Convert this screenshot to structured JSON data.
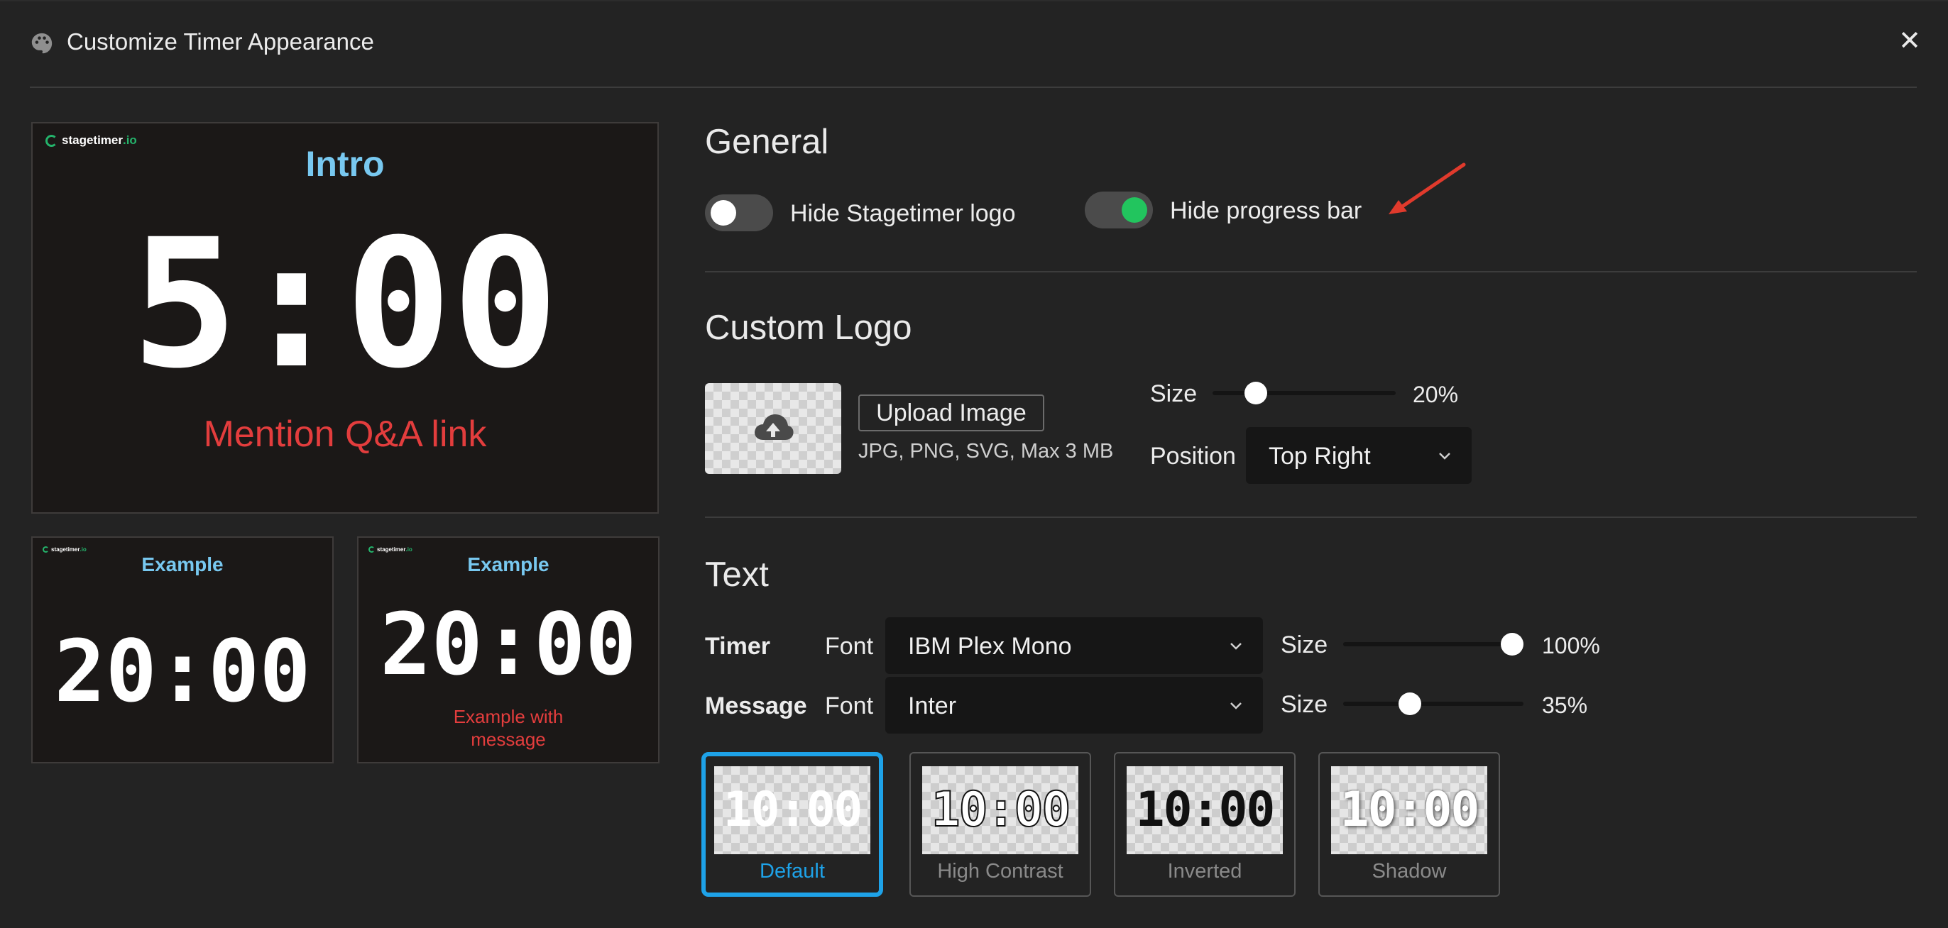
{
  "dialog": {
    "title": "Customize Timer Appearance"
  },
  "preview_main": {
    "logo_text": "stagetimer",
    "logo_suffix": ".io",
    "title": "Intro",
    "timer": "5:00",
    "message": "Mention Q&A link"
  },
  "preview_small1": {
    "logo_text": "stagetimer",
    "logo_suffix": ".io",
    "title": "Example",
    "timer": "20:00"
  },
  "preview_small2": {
    "logo_text": "stagetimer",
    "logo_suffix": ".io",
    "title": "Example",
    "timer": "20:00",
    "message": "Example with message"
  },
  "general": {
    "heading": "General",
    "hide_logo": {
      "label": "Hide Stagetimer logo",
      "on": false
    },
    "hide_progress": {
      "label": "Hide progress bar",
      "on": true
    },
    "annotation_arrow_color": "#e03a2c"
  },
  "custom_logo": {
    "heading": "Custom Logo",
    "upload_label": "Upload Image",
    "hint": "JPG, PNG, SVG, Max 3 MB",
    "size_label": "Size",
    "size_value": 20,
    "size_text": "20%",
    "position_label": "Position",
    "position_value": "Top Right"
  },
  "text": {
    "heading": "Text",
    "timer": {
      "label": "Timer",
      "font_label": "Font",
      "font_value": "IBM Plex Mono",
      "size_label": "Size",
      "size_value": 100,
      "size_text": "100%"
    },
    "message": {
      "label": "Message",
      "font_label": "Font",
      "font_value": "Inter",
      "size_label": "Size",
      "size_value": 35,
      "size_text": "35%"
    },
    "styles": [
      {
        "name": "Default",
        "sample": "10:00",
        "selected": true
      },
      {
        "name": "High Contrast",
        "sample": "10:00",
        "selected": false
      },
      {
        "name": "Inverted",
        "sample": "10:00",
        "selected": false
      },
      {
        "name": "Shadow",
        "sample": "10:00",
        "selected": false
      }
    ]
  },
  "colors": {
    "accent": "#1ea2e8",
    "toggle_on": "#22c55e",
    "title_blue": "#78c8f0",
    "message_red": "#e33d3d",
    "brand_green": "#24b36b"
  }
}
